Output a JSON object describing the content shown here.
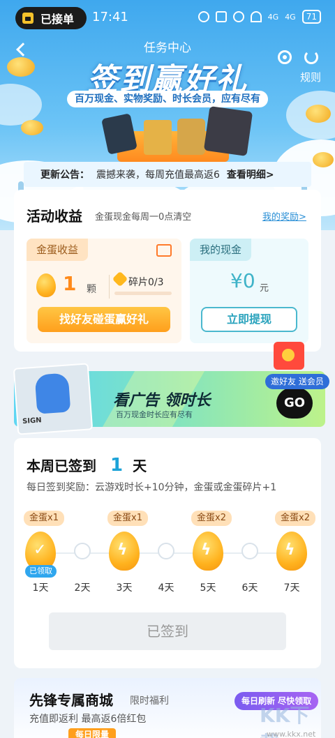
{
  "status_bar": {
    "pill_label": "已接单",
    "time": "17:41",
    "net1": "4G",
    "net2": "4G",
    "battery": "71"
  },
  "nav": {
    "title": "任务中心",
    "rules": "规则"
  },
  "banner": {
    "title": "签到赢好礼",
    "subtitle": "百万现金、实物奖励、时长会员，应有尽有"
  },
  "notice": {
    "head": "更新公告：",
    "text": "震撼来袭，每周充值最高返6",
    "link": "查看明细>"
  },
  "earnings": {
    "title": "活动收益",
    "subtitle": "金蛋现金每周一0点清空",
    "my_rewards": "我的奖励>",
    "egg_box": {
      "label": "金蛋收益",
      "count": "1",
      "unit": "颗",
      "fragment_label": "碎片0/3",
      "fragment_progress": 0,
      "button": "找好友碰蛋赢好礼"
    },
    "cash_box": {
      "label": "我的现金",
      "amount": "¥0",
      "unit": "元",
      "button": "立即提现"
    }
  },
  "ad_banner": {
    "title": "看广告 领时长",
    "subtitle": "百万现金时长应有尽有",
    "go": "GO",
    "invite": "邀好友 送会员",
    "card_text": "SIGN"
  },
  "signin": {
    "title_pre": "本周已签到",
    "count": "1",
    "title_post": "天",
    "desc": "每日签到奖励：云游戏时长+10分钟，金蛋或金蛋碎片+1",
    "claimed": "已领取",
    "button": "已签到",
    "days": [
      {
        "label": "1天",
        "reward": "金蛋x1",
        "claimed": true
      },
      {
        "label": "2天",
        "reward": "",
        "claimed": false
      },
      {
        "label": "3天",
        "reward": "金蛋x1",
        "claimed": false
      },
      {
        "label": "4天",
        "reward": "",
        "claimed": false
      },
      {
        "label": "5天",
        "reward": "金蛋x2",
        "claimed": false
      },
      {
        "label": "6天",
        "reward": "",
        "claimed": false
      },
      {
        "label": "7天",
        "reward": "金蛋x2",
        "claimed": false
      }
    ]
  },
  "shop": {
    "title": "先锋专属商城",
    "limited": "限时福利",
    "desc": "充值即返利 最高返6倍红包",
    "refresh": "每日刷新 尽快领取",
    "daily": "每日限量",
    "watermark": "KK下载",
    "watermark_url": "www.kkx.net"
  },
  "colors": {
    "sky": "#3fa8ee",
    "orange": "#ff9f1c",
    "teal": "#4ab8ce",
    "purple": "#7b5cf0"
  }
}
